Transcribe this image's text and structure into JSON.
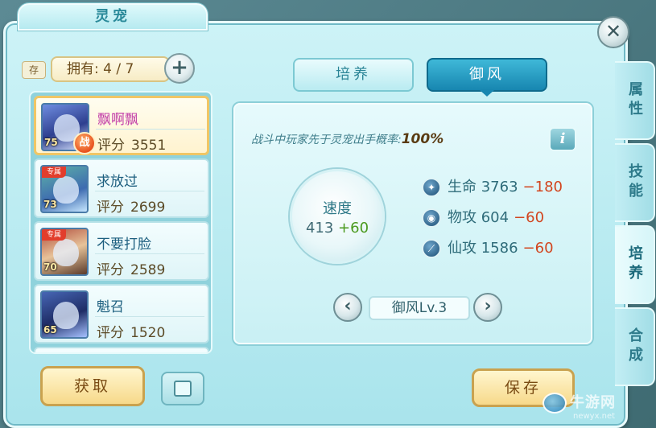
{
  "window": {
    "title": "灵宠",
    "close_label": "✕"
  },
  "left_panel": {
    "store_label": "存",
    "owned_label": "拥有: 4 / 7",
    "add_label": "+",
    "pets": [
      {
        "name": "飘啊飘",
        "score_label": "评分",
        "score": "3551",
        "level": "75",
        "badge": "战",
        "selected": true
      },
      {
        "name": "求放过",
        "score_label": "评分",
        "score": "2699",
        "level": "73",
        "badge": "专属",
        "selected": false
      },
      {
        "name": "不要打脸",
        "score_label": "评分",
        "score": "2589",
        "level": "70",
        "badge": "专属",
        "selected": false
      },
      {
        "name": "魁召",
        "score_label": "评分",
        "score": "1520",
        "level": "65",
        "badge": "",
        "selected": false
      }
    ],
    "get_button": "获取"
  },
  "tabs": [
    {
      "label": "培养",
      "active": false
    },
    {
      "label": "御风",
      "active": true
    }
  ],
  "content": {
    "description": "战斗中玩家先于灵宠出手概率:",
    "probability": "100%",
    "info_label": "i",
    "speed": {
      "label": "速度",
      "value": "413",
      "bonus": "+60"
    },
    "stats": [
      {
        "icon": "life-icon",
        "label": "生命",
        "value": "3763",
        "delta": "−180"
      },
      {
        "icon": "physical-attack-icon",
        "label": "物攻",
        "value": "604",
        "delta": "−60"
      },
      {
        "icon": "magic-attack-icon",
        "label": "仙攻",
        "value": "1586",
        "delta": "−60"
      }
    ],
    "level_label": "御风Lv.3",
    "prev_label": "‹",
    "next_label": "›"
  },
  "save_button": "保存",
  "side_tabs": [
    {
      "label": "属性",
      "active": false
    },
    {
      "label": "技能",
      "active": false
    },
    {
      "label": "培养",
      "active": true
    },
    {
      "label": "合成",
      "active": false
    }
  ],
  "watermark": {
    "text": "牛游网",
    "sub": "newyx.net"
  },
  "colors": {
    "panel_bg": "#a9e4ec",
    "active_tab": "#1786b0",
    "gold_button": "#f7d98a",
    "selected_name": "#c23da8",
    "delta_negative": "#d2451e",
    "delta_positive": "#4a9a1e"
  }
}
